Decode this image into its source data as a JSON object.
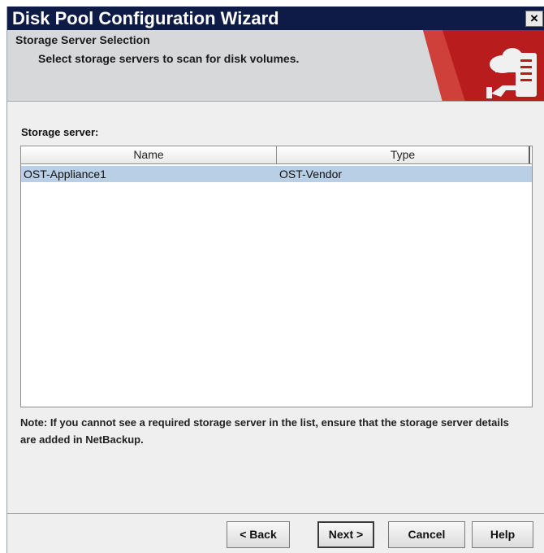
{
  "window": {
    "title": "Disk Pool Configuration Wizard",
    "close_glyph": "×"
  },
  "banner": {
    "heading": "Storage Server Selection",
    "subtitle": "Select storage servers to scan for disk volumes.",
    "icon": "storage-server-icon",
    "accent_color": "#b81c1c"
  },
  "storage_server": {
    "label": "Storage server:",
    "columns": [
      "Name",
      "Type"
    ],
    "rows": [
      {
        "name": "OST-Appliance1",
        "type": "OST-Vendor",
        "selected": true
      }
    ]
  },
  "note": "Note: If you cannot see a required storage server in the list, ensure that the storage server details are added in NetBackup.",
  "buttons": {
    "back": "< Back",
    "next": "Next >",
    "cancel": "Cancel",
    "help": "Help"
  },
  "colors": {
    "titlebar": "#0f1b47",
    "selected_row": "#b8cfe5"
  }
}
